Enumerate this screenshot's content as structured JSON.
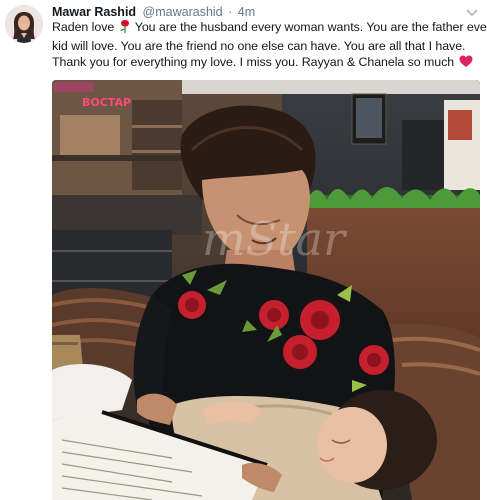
{
  "tweet": {
    "author_name": "Mawar Rashid",
    "author_handle": "@mawarashid",
    "separator": "·",
    "time": "4m",
    "text_lines": [
      "Raden love",
      "You are the husband every woman wants. You are the father every",
      "kid will love. You are the friend no one else can have. You are all that I have.",
      "Thank you for everything my love. I miss you. Rayyan & Chanela so much"
    ],
    "emojis": [
      "rose-emoji",
      "heart-emoji"
    ],
    "media": {
      "neon_sign": "BOCTAP",
      "watermark": "mStar"
    }
  },
  "colors": {
    "name_text": "#14171a",
    "secondary_text": "#657786",
    "heart": "#e0245e",
    "rose": "#d9142b"
  }
}
